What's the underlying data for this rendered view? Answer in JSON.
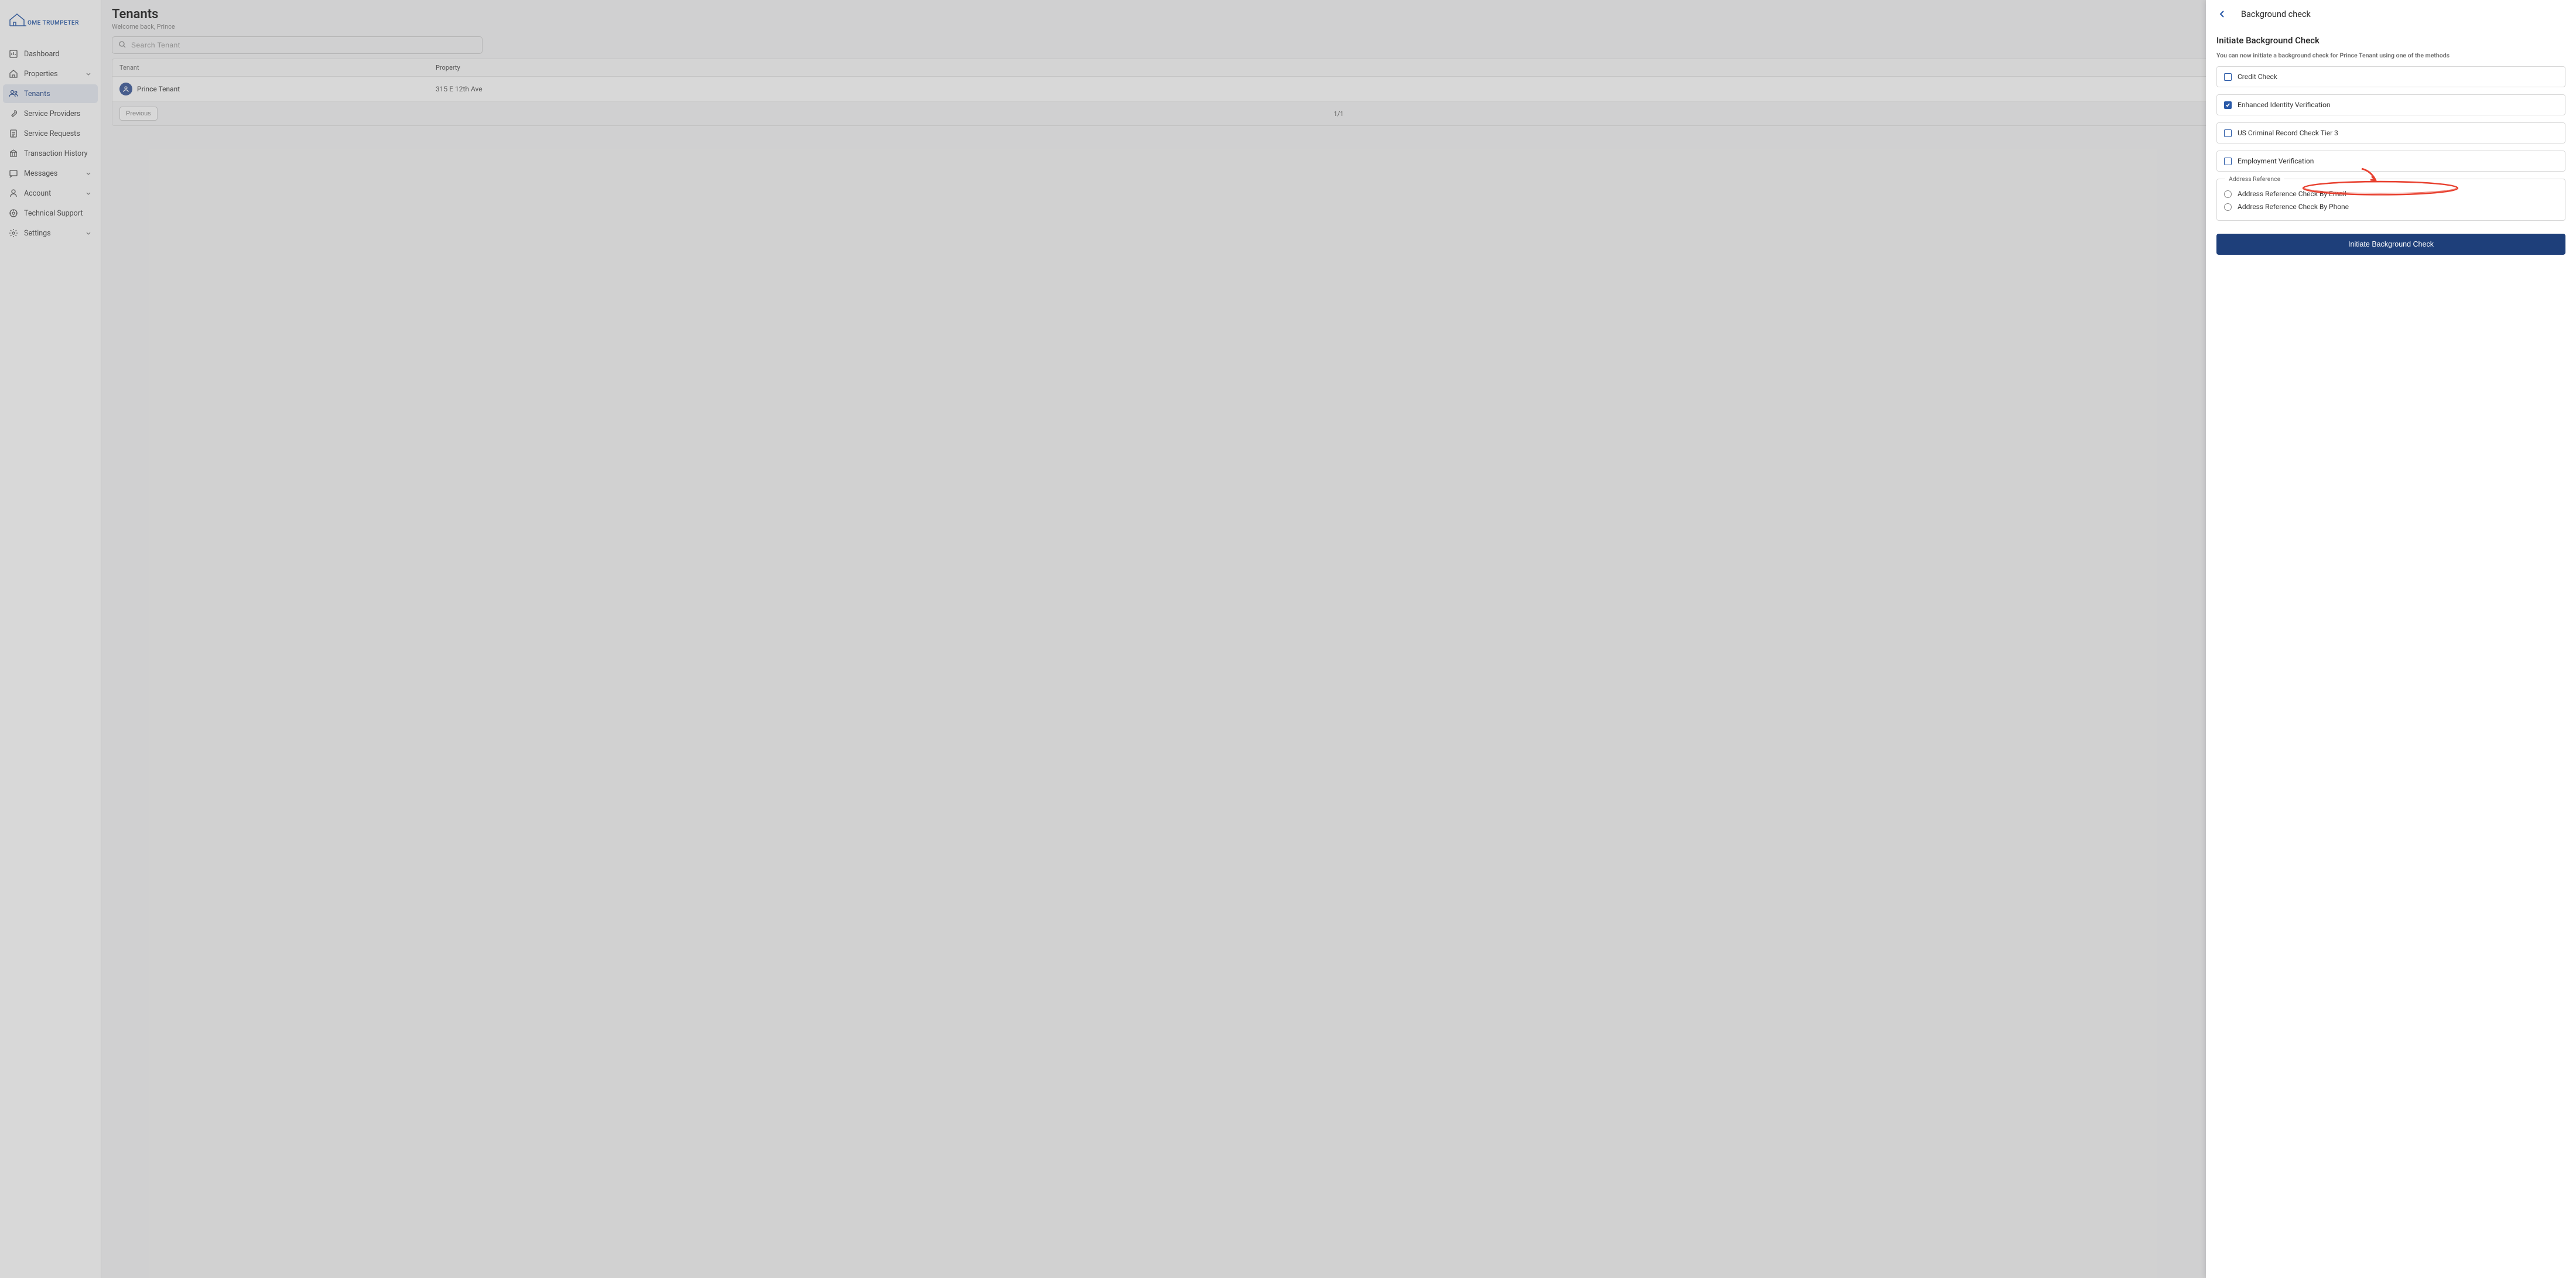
{
  "logo_text": "OME TRUMPETER",
  "sidebar": {
    "items": [
      {
        "label": "Dashboard",
        "icon": "dashboard"
      },
      {
        "label": "Properties",
        "icon": "home",
        "expandable": true
      },
      {
        "label": "Tenants",
        "icon": "users",
        "active": true
      },
      {
        "label": "Service Providers",
        "icon": "wrench"
      },
      {
        "label": "Service Requests",
        "icon": "clipboard"
      },
      {
        "label": "Transaction History",
        "icon": "bank"
      },
      {
        "label": "Messages",
        "icon": "message",
        "expandable": true
      },
      {
        "label": "Account",
        "icon": "user",
        "expandable": true
      },
      {
        "label": "Technical Support",
        "icon": "support"
      },
      {
        "label": "Settings",
        "icon": "gear",
        "expandable": true
      }
    ]
  },
  "page": {
    "title": "Tenants",
    "subtitle": "Welcome back, Prince"
  },
  "search": {
    "placeholder": "Search Tenant"
  },
  "table": {
    "headers": {
      "tenant": "Tenant",
      "property": "Property"
    },
    "rows": [
      {
        "tenant_name": "Prince Tenant",
        "property": "315 E 12th Ave"
      }
    ]
  },
  "pagination": {
    "prev_label": "Previous",
    "indicator": "1/1"
  },
  "drawer": {
    "header_title": "Background check",
    "section_title": "Initiate Background Check",
    "note": "You can now initiate a background check for Prince Tenant using one of the methods",
    "checks": [
      {
        "label": "Credit Check",
        "checked": false
      },
      {
        "label": "Enhanced Identity Verification",
        "checked": true
      },
      {
        "label": "US Criminal Record Check Tier 3",
        "checked": false
      },
      {
        "label": "Employment Verification",
        "checked": false
      }
    ],
    "address_ref": {
      "legend": "Address Reference",
      "options": [
        {
          "label": "Address Reference Check By Email"
        },
        {
          "label": "Address Reference Check By Phone"
        }
      ]
    },
    "submit_label": "Initiate Background Check"
  }
}
